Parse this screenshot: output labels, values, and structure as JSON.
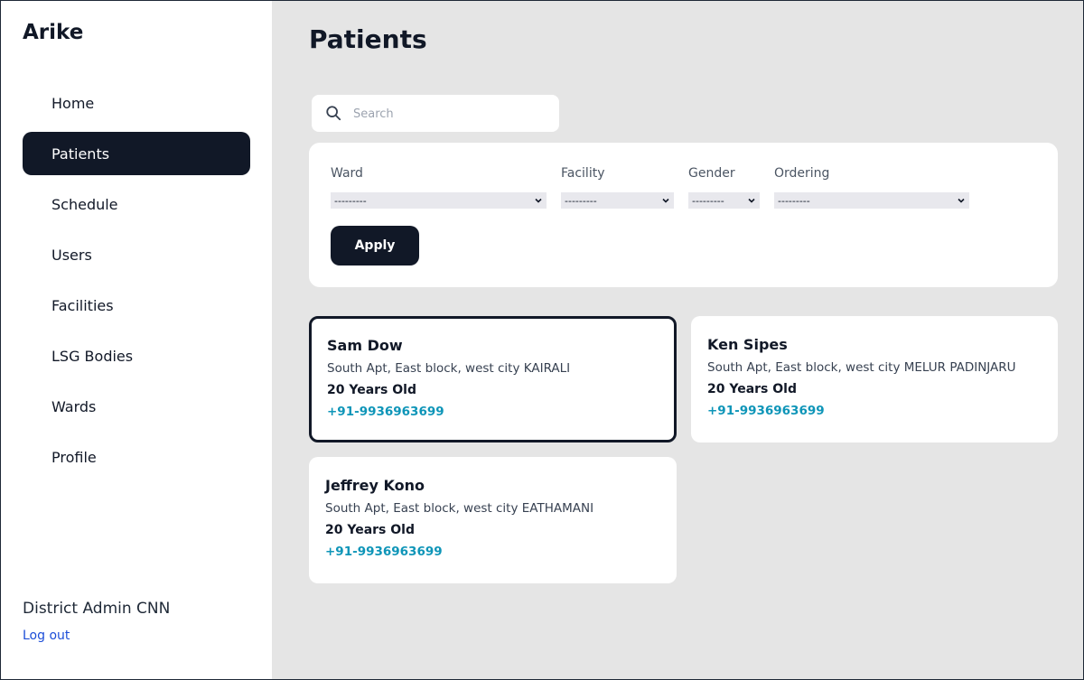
{
  "app": {
    "brand": "Arike"
  },
  "sidebar": {
    "items": [
      {
        "label": "Home"
      },
      {
        "label": "Patients"
      },
      {
        "label": "Schedule"
      },
      {
        "label": "Users"
      },
      {
        "label": "Facilities"
      },
      {
        "label": "LSG Bodies"
      },
      {
        "label": "Wards"
      },
      {
        "label": "Profile"
      }
    ],
    "active_index": 1,
    "user_name": "District Admin CNN",
    "logout_label": "Log out"
  },
  "main": {
    "title": "Patients",
    "search": {
      "placeholder": "Search",
      "value": ""
    },
    "filters": {
      "ward": {
        "label": "Ward",
        "value": "---------"
      },
      "facility": {
        "label": "Facility",
        "value": "---------"
      },
      "gender": {
        "label": "Gender",
        "value": "---------"
      },
      "ordering": {
        "label": "Ordering",
        "value": "---------"
      },
      "apply_label": "Apply"
    },
    "patients": [
      {
        "name": "Sam Dow",
        "address": "South Apt, East block, west city KAIRALI",
        "age": "20 Years Old",
        "phone": "+91-9936963699"
      },
      {
        "name": "Ken Sipes",
        "address": "South Apt, East block, west city MELUR PADINJARU",
        "age": "20 Years Old",
        "phone": "+91-9936963699"
      },
      {
        "name": "Jeffrey Kono",
        "address": "South Apt, East block, west city EATHAMANI",
        "age": "20 Years Old",
        "phone": "+91-9936963699"
      }
    ]
  },
  "colors": {
    "primary": "#111827",
    "link": "#1d4ed8",
    "phone": "#0e95b8",
    "background": "#e5e5e5"
  },
  "icons": {
    "search": "search-icon",
    "select_arrow": "chevron-down-icon"
  }
}
